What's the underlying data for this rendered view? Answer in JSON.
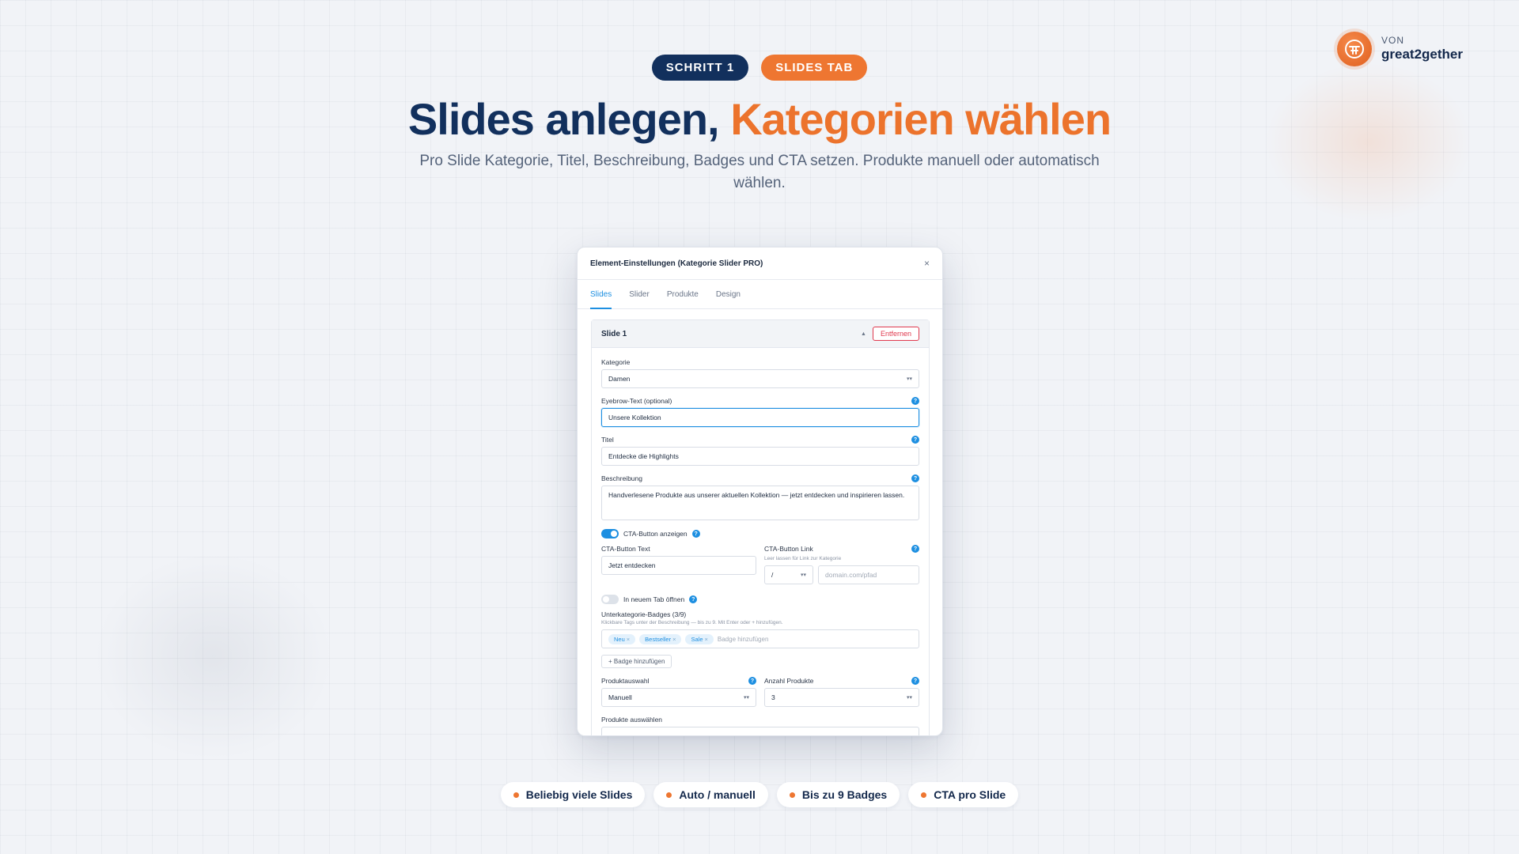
{
  "brand": {
    "von": "VON",
    "name": "great2gether"
  },
  "header": {
    "step_pill": "SCHRITT 1",
    "tab_pill": "SLIDES TAB",
    "headline_main": "Slides anlegen,",
    "headline_accent": "Kategorien wählen",
    "subline": "Pro Slide Kategorie, Titel, Beschreibung, Badges und CTA setzen. Produkte manuell oder automatisch wählen."
  },
  "modal": {
    "title": "Element-Einstellungen (Kategorie Slider PRO)",
    "close": "×",
    "tabs": [
      {
        "label": "Slides",
        "active": true
      },
      {
        "label": "Slider",
        "active": false
      },
      {
        "label": "Produkte",
        "active": false
      },
      {
        "label": "Design",
        "active": false
      }
    ],
    "slide": {
      "title": "Slide 1",
      "toggle": "▲",
      "remove": "Entfernen",
      "kategorie_label": "Kategorie",
      "kategorie_value": "Damen",
      "eyebrow_label": "Eyebrow-Text (optional)",
      "eyebrow_value": "Unsere Kollektion",
      "titel_label": "Titel",
      "titel_value": "Entdecke die Highlights",
      "beschreibung_label": "Beschreibung",
      "beschreibung_value": "Handverlesene Produkte aus unserer aktuellen Kollektion — jetzt entdecken und inspirieren lassen.",
      "cta_toggle_label": "CTA-Button anzeigen",
      "cta_text_label": "CTA-Button Text",
      "cta_text_value": "Jetzt entdecken",
      "cta_link_label": "CTA-Button Link",
      "cta_link_hint": "Leer lassen für Link zur Kategorie",
      "cta_link_prefix": "/",
      "cta_link_placeholder": "domain.com/pfad",
      "new_tab_label": "In neuem Tab öffnen",
      "badges_label": "Unterkategorie-Badges (3/9)",
      "badges_hint": "Klickbare Tags unter der Beschreibung — bis zu 9. Mit Enter oder + hinzufügen.",
      "badges": [
        "Neu",
        "Bestseller",
        "Sale"
      ],
      "badge_remove": "×",
      "badge_placeholder": "Badge hinzufügen",
      "add_badge_button": "+ Badge hinzufügen",
      "produktauswahl_label": "Produktauswahl",
      "produktauswahl_value": "Manuell",
      "anzahl_label": "Anzahl Produkte",
      "anzahl_value": "3",
      "produkte_auswaehlen_label": "Produkte auswählen",
      "help": "?",
      "select_caret": "▾▾"
    }
  },
  "features": [
    "Beliebig viele Slides",
    "Auto / manuell",
    "Bis zu 9 Badges",
    "CTA pro Slide"
  ],
  "colors": {
    "navy": "#12305d",
    "orange": "#ee7631",
    "accent_blue": "#1d8fe1",
    "danger": "#e0394e"
  }
}
